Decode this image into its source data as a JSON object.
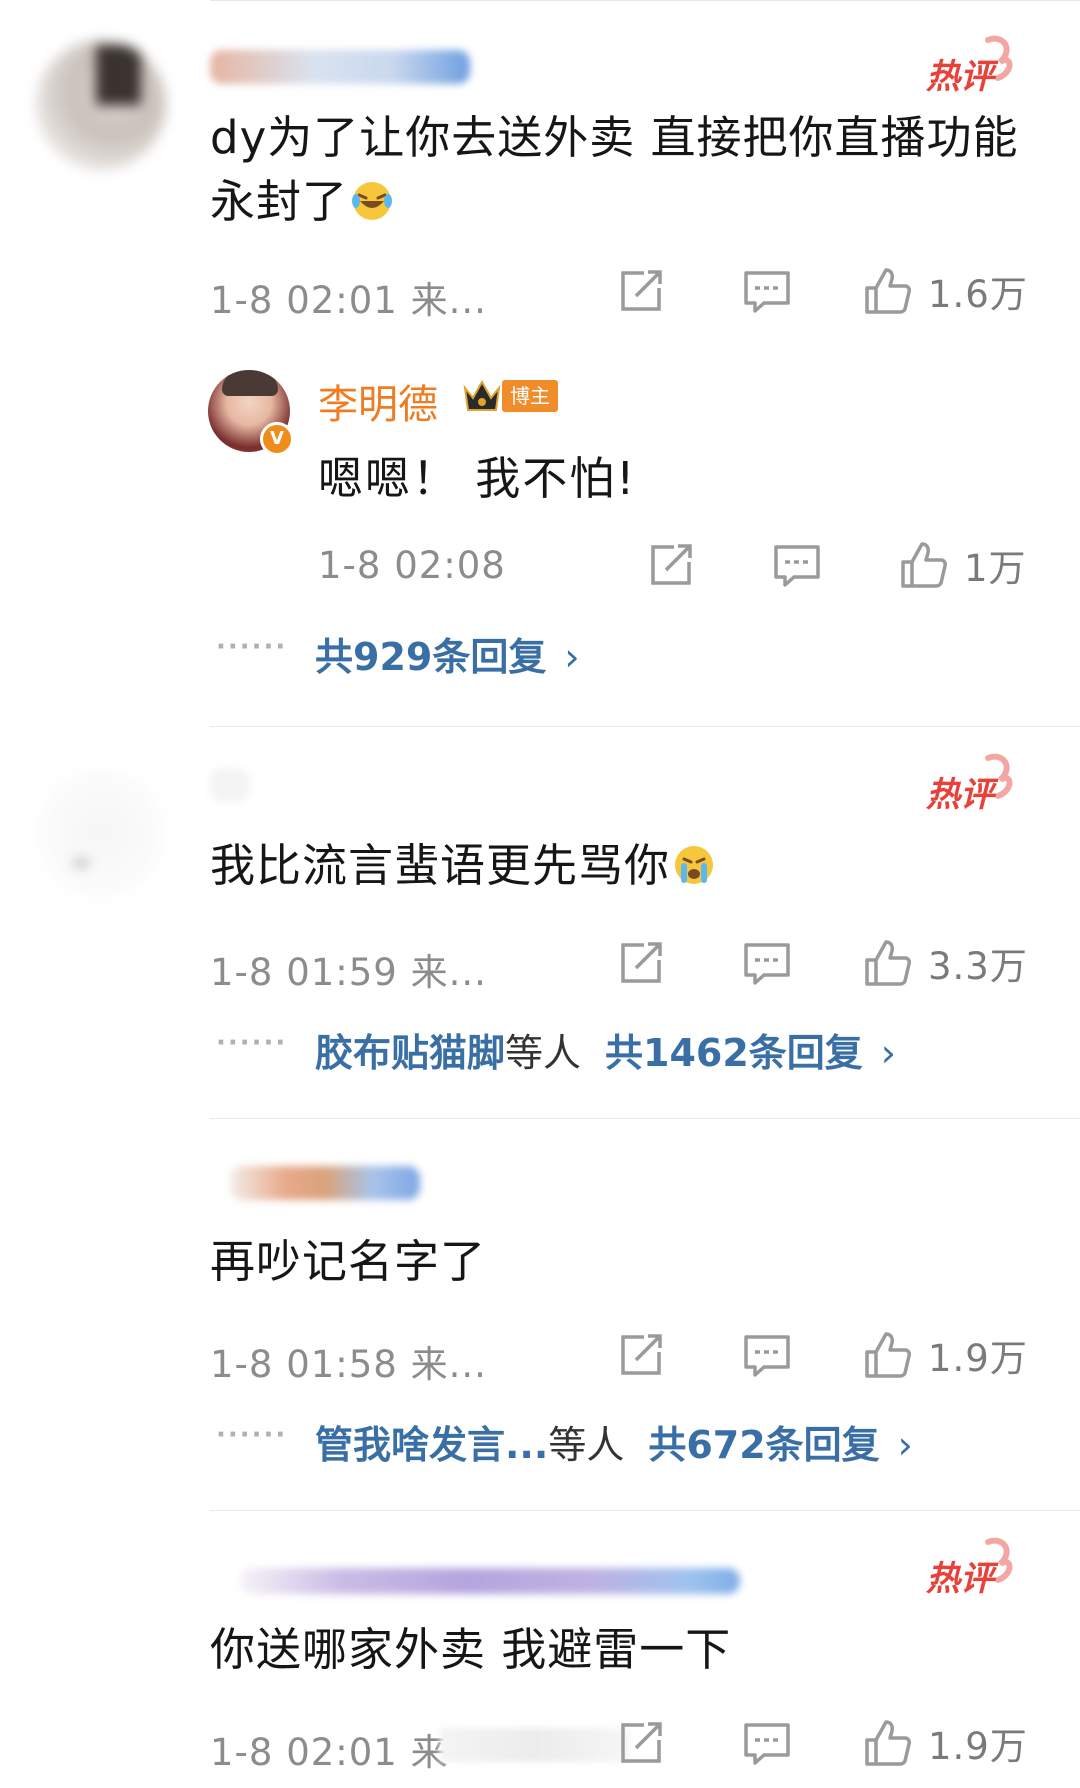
{
  "comments": [
    {
      "hot_label": "热评",
      "text": "dy为了让你去送外卖 直接把你直播功能永封了",
      "emoji": "laughing-crying-emoji",
      "time": "1-8 02:01 来...",
      "likes": "1.6万",
      "reply": {
        "author": "李明德",
        "badge": "博主",
        "verified_mark": "V",
        "text": "嗯嗯！ 我不怕!",
        "time": "1-8 02:08",
        "likes": "1万"
      },
      "replies_dots": "······",
      "replies_link": "共929条回复",
      "chevron": "›"
    },
    {
      "hot_label": "热评",
      "text": "我比流言蜚语更先骂你",
      "emoji": "crying-emoji",
      "time": "1-8 01:59 来...",
      "likes": "3.3万",
      "replies_dots": "······",
      "replies_user": "胶布贴猫脚",
      "replies_others": "等人",
      "replies_link": "共1462条回复",
      "chevron": "›"
    },
    {
      "text": "再吵记名字了",
      "time": "1-8 01:58 来...",
      "likes": "1.9万",
      "replies_dots": "······",
      "replies_user": "管我啥发言...",
      "replies_others": "等人",
      "replies_link": "共672条回复",
      "chevron": "›"
    },
    {
      "hot_label": "热评",
      "text": "你送哪家外卖 我避雷一下",
      "time": "1-8 02:01 来",
      "likes": "1.9万"
    }
  ],
  "colors": {
    "link_blue": "#3a6fa6",
    "author_orange": "#f07b20",
    "hot_red": "#e8413a",
    "meta_gray": "#8c8c8c"
  }
}
